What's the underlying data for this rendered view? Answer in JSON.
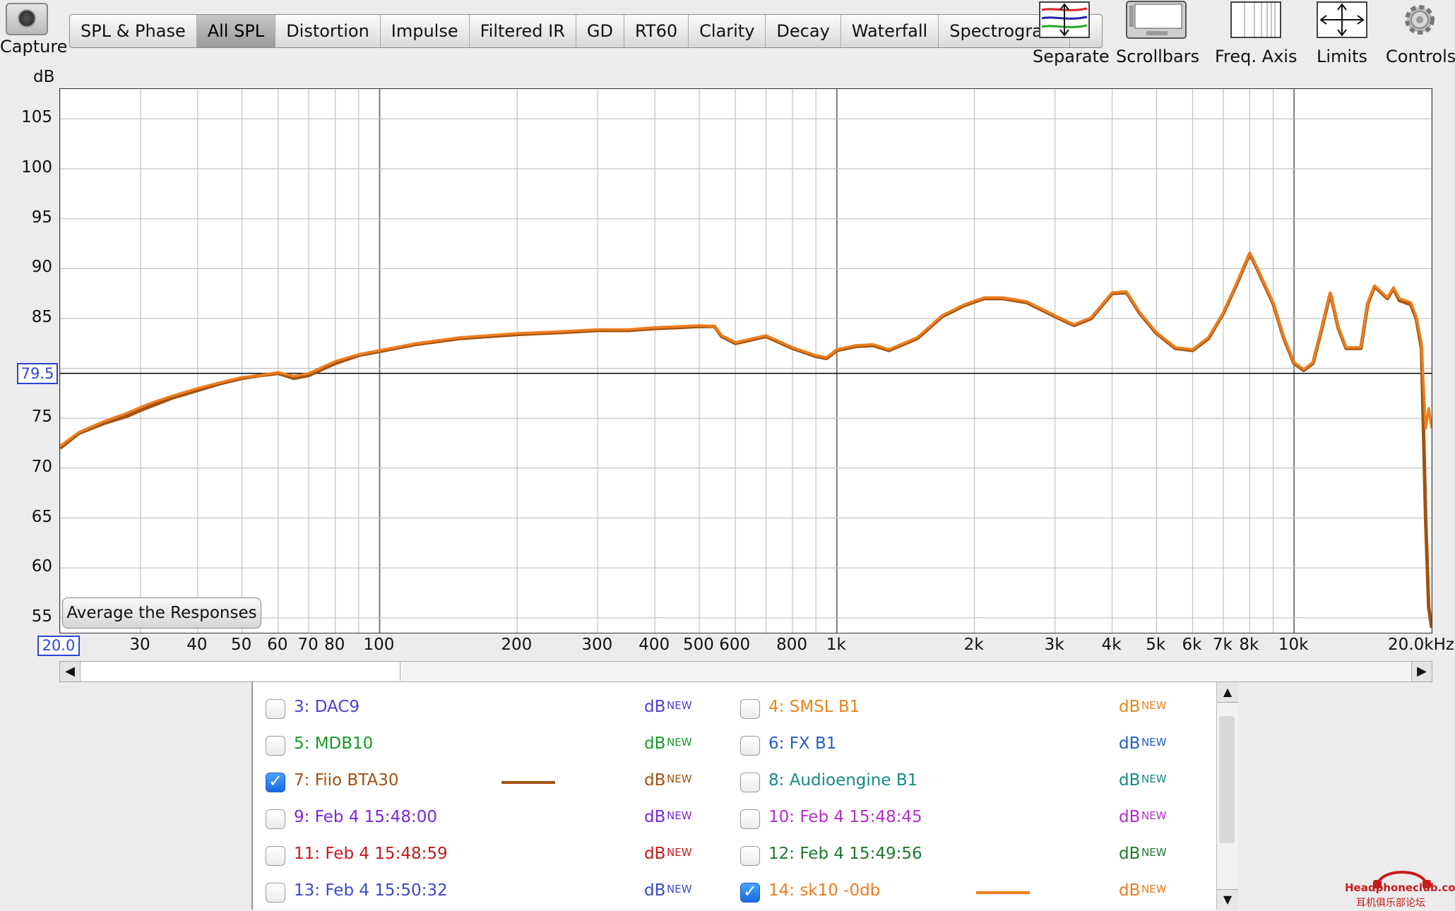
{
  "toolbar": {
    "capture_label": "Capture",
    "tabs": [
      "SPL & Phase",
      "All SPL",
      "Distortion",
      "Impulse",
      "Filtered IR",
      "GD",
      "RT60",
      "Clarity",
      "Decay",
      "Waterfall",
      "Spectrogram",
      "»"
    ],
    "active_tab": "All SPL",
    "tools": [
      {
        "label": "Separate",
        "icon": "separate-icon"
      },
      {
        "label": "Scrollbars",
        "icon": "scrollbars-icon"
      },
      {
        "label": "Freq. Axis",
        "icon": "freq-axis-icon"
      },
      {
        "label": "Limits",
        "icon": "limits-icon"
      },
      {
        "label": "Controls",
        "icon": "gear-icon"
      }
    ]
  },
  "plot": {
    "y_unit": "dB",
    "reference_level": "79.5",
    "x_min_label": "20.0",
    "x_max_label": "20.0kHz",
    "average_button": "Average the Responses"
  },
  "chart_data": {
    "type": "line",
    "xscale": "log",
    "xlim": [
      20,
      20000
    ],
    "ylim": [
      53.5,
      108
    ],
    "yticks": [
      105,
      100,
      95,
      90,
      85,
      75,
      70,
      65,
      60,
      55
    ],
    "xticks": [
      {
        "v": 30,
        "label": "30"
      },
      {
        "v": 40,
        "label": "40"
      },
      {
        "v": 50,
        "label": "50"
      },
      {
        "v": 60,
        "label": "60"
      },
      {
        "v": 70,
        "label": "70"
      },
      {
        "v": 80,
        "label": "80"
      },
      {
        "v": 100,
        "label": "100"
      },
      {
        "v": 200,
        "label": "200"
      },
      {
        "v": 300,
        "label": "300"
      },
      {
        "v": 400,
        "label": "400"
      },
      {
        "v": 500,
        "label": "500"
      },
      {
        "v": 600,
        "label": "600"
      },
      {
        "v": 800,
        "label": "800"
      },
      {
        "v": 1000,
        "label": "1k"
      },
      {
        "v": 2000,
        "label": "2k"
      },
      {
        "v": 3000,
        "label": "3k"
      },
      {
        "v": 4000,
        "label": "4k"
      },
      {
        "v": 5000,
        "label": "5k"
      },
      {
        "v": 6000,
        "label": "6k"
      },
      {
        "v": 7000,
        "label": "7k"
      },
      {
        "v": 8000,
        "label": "8k"
      },
      {
        "v": 10000,
        "label": "10k"
      }
    ],
    "reference_line": 79.5,
    "series": [
      {
        "name": "7: Fiio BTA30",
        "color": "#a0520f",
        "x": [
          20,
          22,
          25,
          28,
          30,
          32,
          35,
          40,
          45,
          50,
          55,
          60,
          65,
          70,
          80,
          90,
          100,
          120,
          150,
          200,
          250,
          300,
          350,
          400,
          450,
          500,
          540,
          560,
          600,
          700,
          800,
          900,
          950,
          1000,
          1100,
          1200,
          1300,
          1500,
          1700,
          1900,
          2100,
          2300,
          2600,
          3000,
          3300,
          3600,
          4000,
          4300,
          4600,
          5000,
          5500,
          6000,
          6500,
          7000,
          7500,
          8000,
          8300,
          9000,
          9500,
          10000,
          10500,
          11000,
          11500,
          12000,
          12500,
          13000,
          14000,
          14500,
          15000,
          16000,
          16500,
          17000,
          18000,
          18500,
          19000,
          19400,
          19700,
          20000
        ],
        "y": [
          72,
          73.5,
          74.5,
          75.2,
          75.8,
          76.3,
          77,
          77.8,
          78.5,
          79,
          79.3,
          79.5,
          79,
          79.3,
          80.5,
          81.3,
          81.7,
          82.4,
          83,
          83.4,
          83.6,
          83.8,
          83.8,
          84,
          84.1,
          84.2,
          84.2,
          83.2,
          82.5,
          83.2,
          82,
          81.2,
          81,
          81.8,
          82.2,
          82.3,
          81.8,
          83,
          85.2,
          86.3,
          87,
          87,
          86.6,
          85.2,
          84.3,
          85,
          87.5,
          87.6,
          85.5,
          83.5,
          82,
          81.8,
          83,
          85.5,
          88.5,
          91.5,
          90,
          86.5,
          83,
          80.5,
          79.8,
          80.5,
          84,
          87.5,
          84,
          82,
          82,
          86.5,
          88.2,
          87,
          88,
          86.8,
          86.4,
          85,
          82,
          65,
          56,
          54
        ]
      },
      {
        "name": "14: sk10 -0db",
        "color": "#ed7d1e",
        "x": [
          20,
          22,
          25,
          28,
          30,
          32,
          35,
          40,
          45,
          50,
          55,
          60,
          65,
          70,
          80,
          90,
          100,
          120,
          150,
          200,
          250,
          300,
          350,
          400,
          450,
          500,
          540,
          560,
          600,
          700,
          800,
          900,
          950,
          1000,
          1100,
          1200,
          1300,
          1500,
          1700,
          1900,
          2100,
          2300,
          2600,
          3000,
          3300,
          3600,
          4000,
          4300,
          4600,
          5000,
          5500,
          6000,
          6500,
          7000,
          7500,
          8000,
          8300,
          9000,
          9500,
          10000,
          10500,
          11000,
          11500,
          12000,
          12500,
          13000,
          14000,
          14500,
          15000,
          16000,
          16500,
          17000,
          18000,
          18500,
          19000,
          19400,
          19700,
          20000
        ],
        "y": [
          72.2,
          73.6,
          74.7,
          75.5,
          76.1,
          76.6,
          77.2,
          78,
          78.6,
          79.1,
          79.3,
          79.6,
          79.2,
          79.5,
          80.7,
          81.4,
          81.8,
          82.5,
          83.1,
          83.5,
          83.7,
          83.9,
          83.9,
          84.1,
          84.2,
          84.3,
          84.2,
          83.3,
          82.6,
          83.3,
          82.1,
          81.3,
          81.1,
          81.9,
          82.3,
          82.4,
          81.9,
          83.1,
          85.3,
          86.4,
          87.1,
          87.1,
          86.7,
          85.3,
          84.4,
          85.1,
          87.6,
          87.7,
          85.6,
          83.6,
          82.1,
          81.9,
          83.1,
          85.6,
          88.6,
          91.6,
          90.1,
          86.6,
          83.1,
          80.6,
          79.9,
          80.6,
          84.1,
          87.6,
          84.1,
          82.1,
          82.1,
          86.6,
          88.3,
          87.1,
          88.1,
          87,
          86.6,
          85.2,
          82.5,
          74,
          76,
          74
        ]
      }
    ]
  },
  "measurements": [
    {
      "id": "3",
      "name": "3: DAC9",
      "color": "#4a3fd6",
      "checked": false,
      "swatch": false
    },
    {
      "id": "4",
      "name": "4: SMSL B1",
      "color": "#e8861a",
      "checked": false,
      "swatch": false
    },
    {
      "id": "5",
      "name": "5: MDB10",
      "color": "#159a2a",
      "checked": false,
      "swatch": false
    },
    {
      "id": "6",
      "name": "6: FX B1",
      "color": "#1f5fc8",
      "checked": false,
      "swatch": false
    },
    {
      "id": "7",
      "name": "7: Fiio BTA30",
      "color": "#a0520f",
      "checked": true,
      "swatch": true
    },
    {
      "id": "8",
      "name": "8: Audioengine B1",
      "color": "#158a86",
      "checked": false,
      "swatch": false
    },
    {
      "id": "9",
      "name": "9: Feb 4 15:48:00",
      "color": "#7a28d6",
      "checked": false,
      "swatch": false
    },
    {
      "id": "10",
      "name": "10: Feb 4 15:48:45",
      "color": "#b32fc9",
      "checked": false,
      "swatch": false
    },
    {
      "id": "11",
      "name": "11: Feb 4 15:48:59",
      "color": "#c41a1a",
      "checked": false,
      "swatch": false
    },
    {
      "id": "12",
      "name": "12: Feb 4 15:49:56",
      "color": "#1c7a2e",
      "checked": false,
      "swatch": false
    },
    {
      "id": "13",
      "name": "13: Feb 4 15:50:32",
      "color": "#3b47c9",
      "checked": false,
      "swatch": false
    },
    {
      "id": "14",
      "name": "14: sk10 -0db",
      "color": "#ed7d1e",
      "checked": true,
      "swatch": true
    }
  ],
  "measurement_db_label": "dB",
  "measurement_new_label": "NEW",
  "watermark": {
    "line1": "Headphoneclub.com",
    "line2": "耳机俱乐部论坛"
  }
}
